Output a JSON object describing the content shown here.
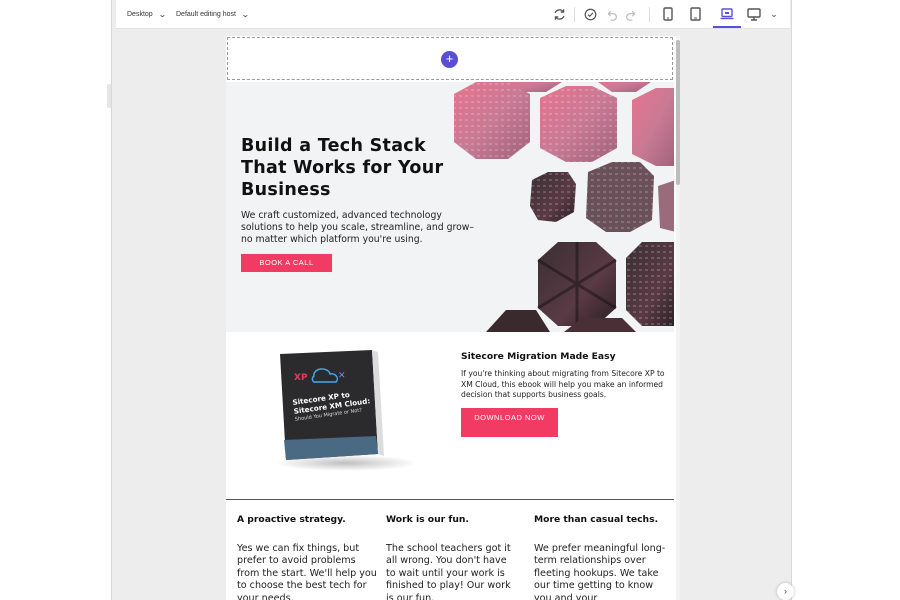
{
  "toolbar": {
    "device_dropdown": "Desktop",
    "host_dropdown": "Default editing host",
    "icons": [
      "refresh-icon",
      "check-circle-icon",
      "undo-icon",
      "redo-icon",
      "mobile-icon",
      "tablet-icon",
      "laptop-icon",
      "desktop-icon",
      "chevron-down-icon"
    ],
    "active_device": "laptop",
    "accent": "#5b4fd6"
  },
  "placeholder": {
    "add_symbol": "+"
  },
  "hero": {
    "title": "Build a Tech Stack That Works for Your Business",
    "text": "We craft customized, advanced technology solutions to help you scale, streamline, and grow–no matter which platform you're using.",
    "cta": "BOOK A CALL",
    "cta_color": "#f23b62"
  },
  "ebook": {
    "title": "Sitecore Migration Made Easy",
    "text": "If you're thinking about migrating from Sitecore XP to XM Cloud, this ebook will help you make an informed decision that supports business goals.",
    "cta": "DOWNLOAD NOW",
    "cover_title": "Sitecore XP to Sitecore XM Cloud:",
    "cover_subtitle": "Should You Migrate or Not?"
  },
  "features": [
    {
      "title": "A proactive strategy.",
      "text": "Yes we can fix things, but prefer to avoid problems from the start. We'll help you to choose the best tech for your needs."
    },
    {
      "title": "Work is our fun.",
      "text": "The school teachers got it all wrong. You don't have to wait until your work is finished to play! Our work is our fun."
    },
    {
      "title": "More than casual techs.",
      "text": "We prefer meaningful long-term relationships over fleeting hookups. We take our time getting to know you and your"
    }
  ]
}
